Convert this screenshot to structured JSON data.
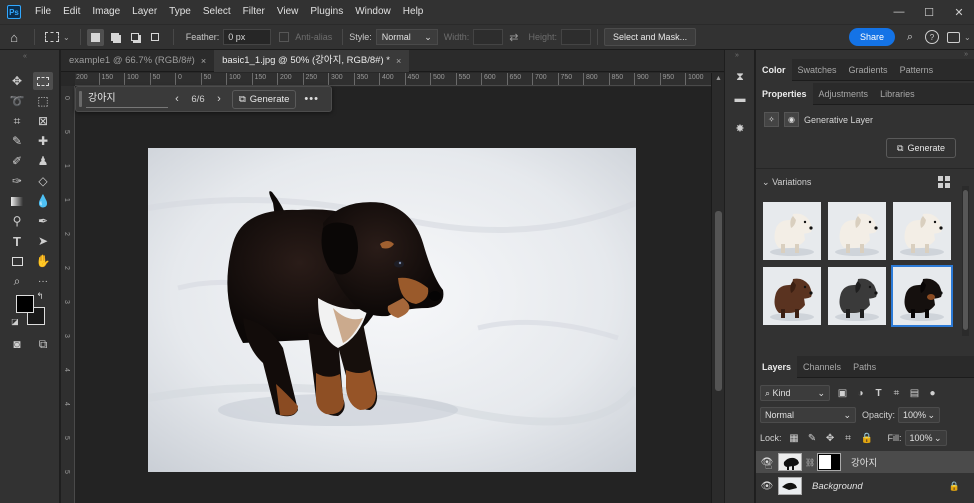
{
  "app": {
    "logo_text": "Ps"
  },
  "menu": [
    "File",
    "Edit",
    "Image",
    "Layer",
    "Type",
    "Select",
    "Filter",
    "View",
    "Plugins",
    "Window",
    "Help"
  ],
  "window_controls": [
    "—",
    "☐",
    "✕"
  ],
  "options_bar": {
    "feather_label": "Feather:",
    "feather_value": "0 px",
    "antialias_label": "Anti-alias",
    "style_label": "Style:",
    "style_value": "Normal",
    "width_label": "Width:",
    "height_label": "Height:",
    "select_mask_label": "Select and Mask...",
    "share_label": "Share"
  },
  "tabs": [
    {
      "label": "example1 @ 66.7% (RGB/8#)",
      "close": "×",
      "active": false
    },
    {
      "label": "basic1_1.jpg @ 50% (강아지, RGB/8#) *",
      "close": "×",
      "active": true
    }
  ],
  "ruler_h": [
    "200",
    "150",
    "100",
    "50",
    "0",
    "50",
    "100",
    "150",
    "200",
    "250",
    "300",
    "350",
    "400",
    "450",
    "500",
    "550",
    "600",
    "650",
    "700",
    "750",
    "800",
    "850",
    "900",
    "950",
    "1000",
    "1050",
    "1100",
    "1150",
    "1200",
    "1250"
  ],
  "ruler_v": [
    "0",
    "5",
    "1",
    "1",
    "2",
    "2",
    "3",
    "3",
    "4",
    "4",
    "5",
    "5"
  ],
  "context_bar": {
    "prompt": "강아지",
    "count": "6/6",
    "generate_label": "Generate",
    "prev": "‹",
    "next": "›",
    "more": "•••"
  },
  "right_panel": {
    "top_tabs": [
      "Color",
      "Swatches",
      "Gradients",
      "Patterns"
    ],
    "props_tabs": [
      "Properties",
      "Adjustments",
      "Libraries"
    ],
    "layer_type": "Generative Layer",
    "generate_label": "Generate",
    "variations_label": "Variations",
    "variations": [
      {
        "dog": "white",
        "selected": false
      },
      {
        "dog": "white",
        "selected": false
      },
      {
        "dog": "white",
        "selected": false
      },
      {
        "dog": "brown",
        "selected": false
      },
      {
        "dog": "gray",
        "selected": false
      },
      {
        "dog": "black",
        "selected": true
      }
    ]
  },
  "layers_panel": {
    "tabs": [
      "Layers",
      "Channels",
      "Paths"
    ],
    "filter_kind": "Kind",
    "blend_mode": "Normal",
    "opacity_label": "Opacity:",
    "opacity_value": "100%",
    "lock_label": "Lock:",
    "fill_label": "Fill:",
    "fill_value": "100%",
    "layers": [
      {
        "name": "강아지",
        "active": true,
        "has_mask": true,
        "locked": false
      },
      {
        "name": "Background",
        "active": false,
        "has_mask": false,
        "locked": true
      }
    ]
  },
  "colors": {
    "accent": "#1473e6",
    "selection": "#2c7ad6",
    "panel": "#323232",
    "canvas_bg": "#232323"
  }
}
